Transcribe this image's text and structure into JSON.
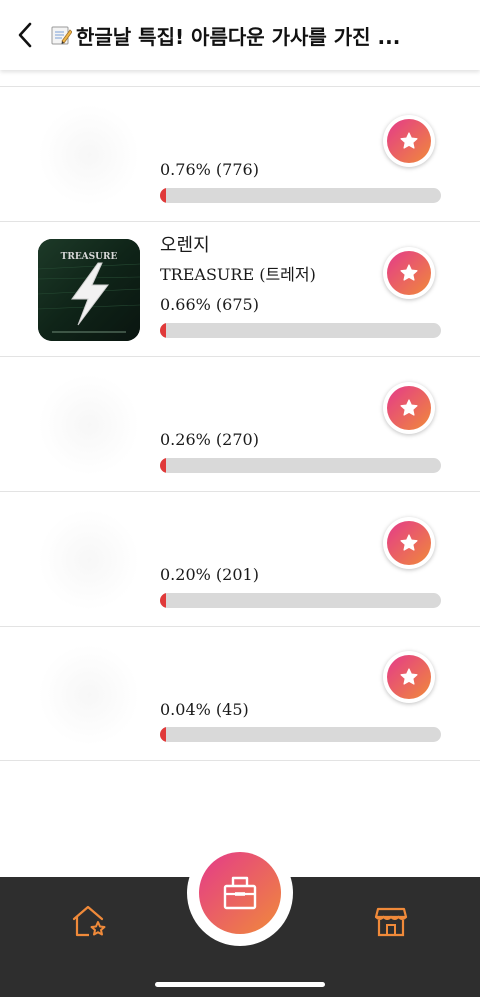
{
  "header": {
    "title": "한글날 특집! 아름다운 가사를 가진 ...",
    "back_icon": "chevron-left-icon",
    "title_icon": "memo-icon"
  },
  "rows": [
    {
      "song": "",
      "artist": "",
      "stat": "0.76% (776)",
      "percent": 0.76,
      "thumb": "blank"
    },
    {
      "song": "오렌지",
      "artist": "TREASURE (트레저)",
      "stat": "0.66% (675)",
      "percent": 0.66,
      "thumb": "treasure",
      "thumb_text": "TREASURE"
    },
    {
      "song": "",
      "artist": "",
      "stat": "0.26% (270)",
      "percent": 0.26,
      "thumb": "blank"
    },
    {
      "song": "",
      "artist": "",
      "stat": "0.20% (201)",
      "percent": 0.2,
      "thumb": "blank"
    },
    {
      "song": "",
      "artist": "",
      "stat": "0.04% (45)",
      "percent": 0.04,
      "thumb": "blank"
    }
  ],
  "vote_icon": "star-icon",
  "bottom_nav": {
    "left_icon": "home-star-icon",
    "center_icon": "ballot-box-icon",
    "right_icon": "store-icon"
  },
  "colors": {
    "accent_start": "#e43a8a",
    "accent_end": "#f08a3a",
    "nav_bg": "#2e2e2e",
    "nav_icon": "#f08a3a",
    "bar_fill": "#e03a3a",
    "bar_track": "#d9d9d9"
  }
}
